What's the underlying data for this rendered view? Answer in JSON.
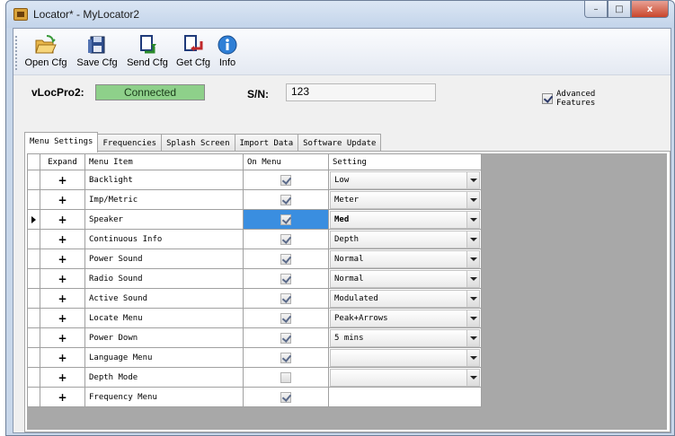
{
  "window": {
    "title": "Locator* - MyLocator2",
    "controls": {
      "minimize": "–",
      "maximize": "□",
      "close": "x"
    }
  },
  "toolbar": {
    "buttons": [
      {
        "label": "Open Cfg",
        "icon": "folder-open-icon"
      },
      {
        "label": "Save Cfg",
        "icon": "save-icon"
      },
      {
        "label": "Send Cfg",
        "icon": "send-config-icon"
      },
      {
        "label": "Get Cfg",
        "icon": "get-config-icon"
      },
      {
        "label": "Info",
        "icon": "info-icon"
      }
    ]
  },
  "device": {
    "name_label": "vLocPro2:",
    "status": "Connected",
    "status_color": "#8ed08a",
    "sn_label": "S/N:",
    "sn_value": "123"
  },
  "advanced": {
    "label_line1": "Advanced",
    "label_line2": "Features",
    "checked": true
  },
  "tabs": [
    {
      "label": "Menu Settings",
      "active": true
    },
    {
      "label": "Frequencies",
      "active": false
    },
    {
      "label": "Splash Screen",
      "active": false
    },
    {
      "label": "Import Data",
      "active": false
    },
    {
      "label": "Software Update",
      "active": false
    }
  ],
  "grid": {
    "headers": {
      "expand": "Expand",
      "item": "Menu Item",
      "on_menu": "On Menu",
      "setting": "Setting"
    },
    "rows": [
      {
        "expand": "+",
        "item": "Backlight",
        "on_menu": true,
        "setting": "Low",
        "has_combo": true,
        "current": false
      },
      {
        "expand": "+",
        "item": "Imp/Metric",
        "on_menu": true,
        "setting": "Meter",
        "has_combo": true,
        "current": false
      },
      {
        "expand": "+",
        "item": "Speaker",
        "on_menu": true,
        "setting": "Med",
        "has_combo": true,
        "current": true
      },
      {
        "expand": "+",
        "item": "Continuous Info",
        "on_menu": true,
        "setting": "Depth",
        "has_combo": true,
        "current": false
      },
      {
        "expand": "+",
        "item": "Power Sound",
        "on_menu": true,
        "setting": "Normal",
        "has_combo": true,
        "current": false
      },
      {
        "expand": "+",
        "item": "Radio Sound",
        "on_menu": true,
        "setting": "Normal",
        "has_combo": true,
        "current": false
      },
      {
        "expand": "+",
        "item": "Active Sound",
        "on_menu": true,
        "setting": "Modulated",
        "has_combo": true,
        "current": false
      },
      {
        "expand": "+",
        "item": "Locate Menu",
        "on_menu": true,
        "setting": "Peak+Arrows",
        "has_combo": true,
        "current": false
      },
      {
        "expand": "+",
        "item": "Power Down",
        "on_menu": true,
        "setting": "5 mins",
        "has_combo": true,
        "current": false
      },
      {
        "expand": "+",
        "item": "Language Menu",
        "on_menu": true,
        "setting": "",
        "has_combo": true,
        "current": false
      },
      {
        "expand": "+",
        "item": "Depth Mode",
        "on_menu": false,
        "setting": "",
        "has_combo": true,
        "current": false
      },
      {
        "expand": "+",
        "item": "Frequency Menu",
        "on_menu": true,
        "setting": "",
        "has_combo": false,
        "current": false
      }
    ]
  },
  "colors": {
    "selection": "#3a8ee0",
    "grid_background": "#a8a8a8",
    "connected": "#8ed08a"
  }
}
